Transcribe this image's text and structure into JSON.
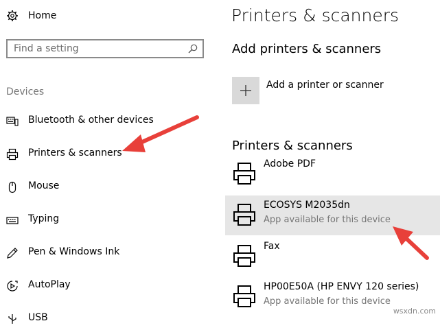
{
  "sidebar": {
    "home_label": "Home",
    "search_placeholder": "Find a setting",
    "section_label": "Devices",
    "items": [
      {
        "label": "Bluetooth & other devices",
        "icon": "keyboard-bluetooth-icon"
      },
      {
        "label": "Printers & scanners",
        "icon": "printer-icon"
      },
      {
        "label": "Mouse",
        "icon": "mouse-icon"
      },
      {
        "label": "Typing",
        "icon": "keyboard-icon"
      },
      {
        "label": "Pen & Windows Ink",
        "icon": "pen-icon"
      },
      {
        "label": "AutoPlay",
        "icon": "autoplay-icon"
      },
      {
        "label": "USB",
        "icon": "usb-icon"
      }
    ]
  },
  "main": {
    "title": "Printers & scanners",
    "add_section": {
      "heading": "Add printers & scanners",
      "add_label": "Add a printer or scanner"
    },
    "list_section": {
      "heading": "Printers & scanners",
      "printers": [
        {
          "name": "Adobe PDF",
          "status": ""
        },
        {
          "name": "ECOSYS M2035dn",
          "status": "App available for this device",
          "selected": true
        },
        {
          "name": "Fax",
          "status": ""
        },
        {
          "name": "HP00E50A (HP ENVY 120 series)",
          "status": "App available for this device"
        }
      ]
    }
  },
  "watermark": "wsxdn.com",
  "colors": {
    "annotation_arrow": "#e8403a",
    "selected_row": "#e6e6e6",
    "secondary_text": "#767676",
    "add_tile": "#d9d9d9"
  }
}
